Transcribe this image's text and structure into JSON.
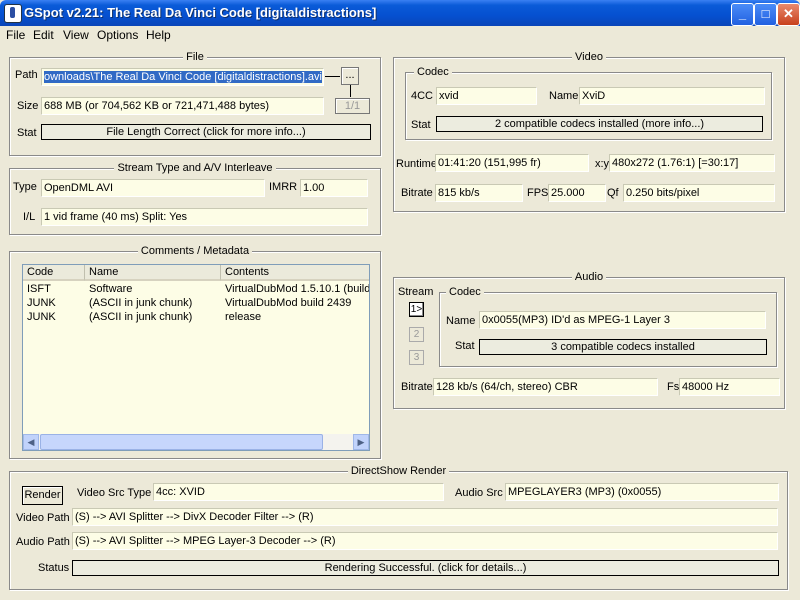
{
  "window": {
    "title": "GSpot v2.21: The Real Da Vinci Code [digitaldistractions]",
    "min": "_",
    "max": "□",
    "close": "✕"
  },
  "menu": [
    "File",
    "Edit",
    "View",
    "Options",
    "Help"
  ],
  "file": {
    "group_title": "File",
    "path_label": "Path",
    "path_value": "ownloads\\The Real Da Vinci Code [digitaldistractions].avi",
    "browse_label": "...",
    "page": "1/1",
    "size_label": "Size",
    "size_value": "688 MB (or 704,562 KB or 721,471,488 bytes)",
    "stat_label": "Stat",
    "stat_value": "File Length Correct (click for more info...)"
  },
  "stream": {
    "group_title": "Stream Type and A/V Interleave",
    "type_label": "Type",
    "type_value": "OpenDML AVI",
    "imrr_label": "IMRR",
    "imrr_value": "1.00",
    "il_label": "I/L",
    "il_value": "1 vid frame (40 ms)  Split: Yes"
  },
  "comments": {
    "group_title": "Comments / Metadata",
    "columns": [
      "Code",
      "Name",
      "Contents"
    ],
    "rows": [
      [
        "ISFT",
        "Software",
        "VirtualDubMod 1.5.10.1 (build"
      ],
      [
        "JUNK",
        "(ASCII in junk chunk)",
        "VirtualDubMod build 2439"
      ],
      [
        "JUNK",
        "(ASCII in junk chunk)",
        "release"
      ]
    ]
  },
  "video": {
    "group_title": "Video",
    "codec_title": "Codec",
    "fourcc_label": "4CC",
    "fourcc_value": "xvid",
    "name_label": "Name",
    "name_value": "XviD",
    "stat_label": "Stat",
    "stat_value": "2 compatible codecs installed (more info...)",
    "runtime_label": "Runtime",
    "runtime_value": "01:41:20 (151,995 fr)",
    "xy_label": "x:y",
    "xy_value": "480x272 (1.76:1) [=30:17]",
    "bitrate_label": "Bitrate",
    "bitrate_value": "815 kb/s",
    "fps_label": "FPS",
    "fps_value": "25.000",
    "qf_label": "Qf",
    "qf_value": "0.250 bits/pixel"
  },
  "audio": {
    "group_title": "Audio",
    "stream_label": "Stream",
    "codec_title": "Codec",
    "streams": [
      "1>",
      "2",
      "3"
    ],
    "name_label": "Name",
    "name_value": "0x0055(MP3) ID'd as MPEG-1 Layer 3",
    "stat_label": "Stat",
    "stat_value": "3 compatible codecs installed",
    "bitrate_label": "Bitrate",
    "bitrate_value": "128 kb/s (64/ch, stereo) CBR",
    "fs_label": "Fs",
    "fs_value": "48000 Hz"
  },
  "render": {
    "group_title": "DirectShow Render",
    "render_button": "Render",
    "vsrc_label": "Video Src Type",
    "vsrc_value": "4cc: XVID",
    "asrc_label": "Audio Src",
    "asrc_value": "MPEGLAYER3 (MP3) (0x0055)",
    "vpath_label": "Video Path",
    "vpath_value": "(S) --> AVI Splitter --> DivX Decoder Filter --> (R)",
    "apath_label": "Audio Path",
    "apath_value": "(S) --> AVI Splitter --> MPEG Layer-3 Decoder --> (R)",
    "status_label": "Status",
    "status_value": "Rendering Successful.  (click for details...)"
  }
}
